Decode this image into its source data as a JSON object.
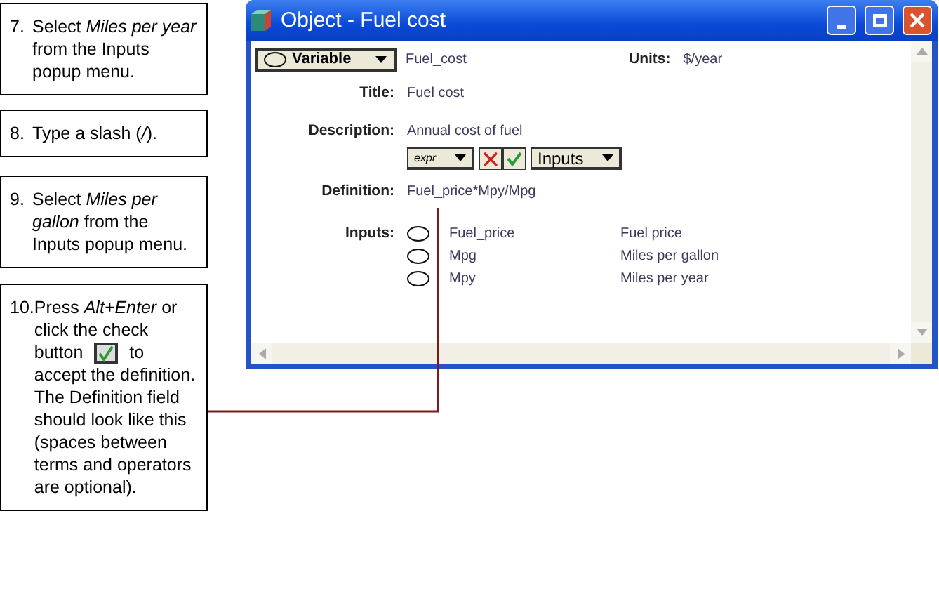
{
  "steps": [
    {
      "number": "7.",
      "text": "Select *Miles per year* from the Inputs popup menu."
    },
    {
      "number": "8.",
      "text": "Type a slash (*/*)."
    },
    {
      "number": "9.",
      "text": "Select *Miles per gallon* from the Inputs popup menu."
    },
    {
      "number": "10.",
      "text": "Press *Alt+Enter* or click the check",
      "before_icon": "button",
      "after_icon": "to",
      "text_continued": "accept the definition. The Definition field should look like this (spaces between terms and operators are optional)."
    }
  ],
  "window": {
    "title": "Object - Fuel cost",
    "class_menu": "Variable",
    "identifier": "Fuel_cost",
    "units_label": "Units:",
    "units": "$/year",
    "fields": [
      {
        "label": "Title:",
        "value": "Fuel cost"
      },
      {
        "label": "Description:",
        "value": "Annual cost of fuel"
      }
    ],
    "toolbar": {
      "mode_menu": "expr",
      "inputs_menu": "Inputs"
    },
    "definition": {
      "label": "Definition:",
      "value": "Fuel_price*Mpy/Mpg"
    },
    "inputs": {
      "label": "Inputs:",
      "items": [
        {
          "identifier": "Fuel_price",
          "title": "Fuel  price"
        },
        {
          "identifier": "Mpg",
          "title": "Miles per gallon"
        },
        {
          "identifier": "Mpy",
          "title": "Miles per year"
        }
      ]
    }
  }
}
